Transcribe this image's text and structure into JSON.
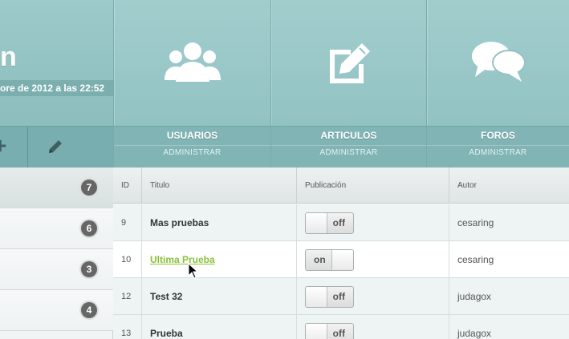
{
  "brand": {
    "title_fragment": "n",
    "date_fragment": "ore de 2012 a las 22:52"
  },
  "toolbar": {
    "add_icon": "plus-icon",
    "edit_icon": "pencil-icon"
  },
  "tiles": [
    {
      "title": "USUARIOS",
      "subtitle": "ADMINISTRAR",
      "icon": "users-icon"
    },
    {
      "title": "ARTICULOS",
      "subtitle": "ADMINISTRAR",
      "icon": "edit-icon"
    },
    {
      "title": "FOROS",
      "subtitle": "ADMINISTRAR",
      "icon": "chat-icon"
    }
  ],
  "sidebar": {
    "items": [
      {
        "badge": "7"
      },
      {
        "badge": "6"
      },
      {
        "badge": "3"
      },
      {
        "badge": "4"
      }
    ]
  },
  "table": {
    "headers": {
      "id": "ID",
      "title": "Titulo",
      "publication": "Publicación",
      "author": "Autor"
    },
    "rows": [
      {
        "id": "9",
        "title": "Mas pruebas",
        "state": "off",
        "author": "cesaring"
      },
      {
        "id": "10",
        "title": "Ultima Prueba",
        "state": "on",
        "author": "cesaring"
      },
      {
        "id": "12",
        "title": "Test 32",
        "state": "off",
        "author": "judagox"
      },
      {
        "id": "13",
        "title": "Prueba",
        "state": "off",
        "author": "judagox"
      }
    ]
  },
  "colors": {
    "header_teal": "#93c3c3",
    "link_green": "#8ac13a"
  }
}
